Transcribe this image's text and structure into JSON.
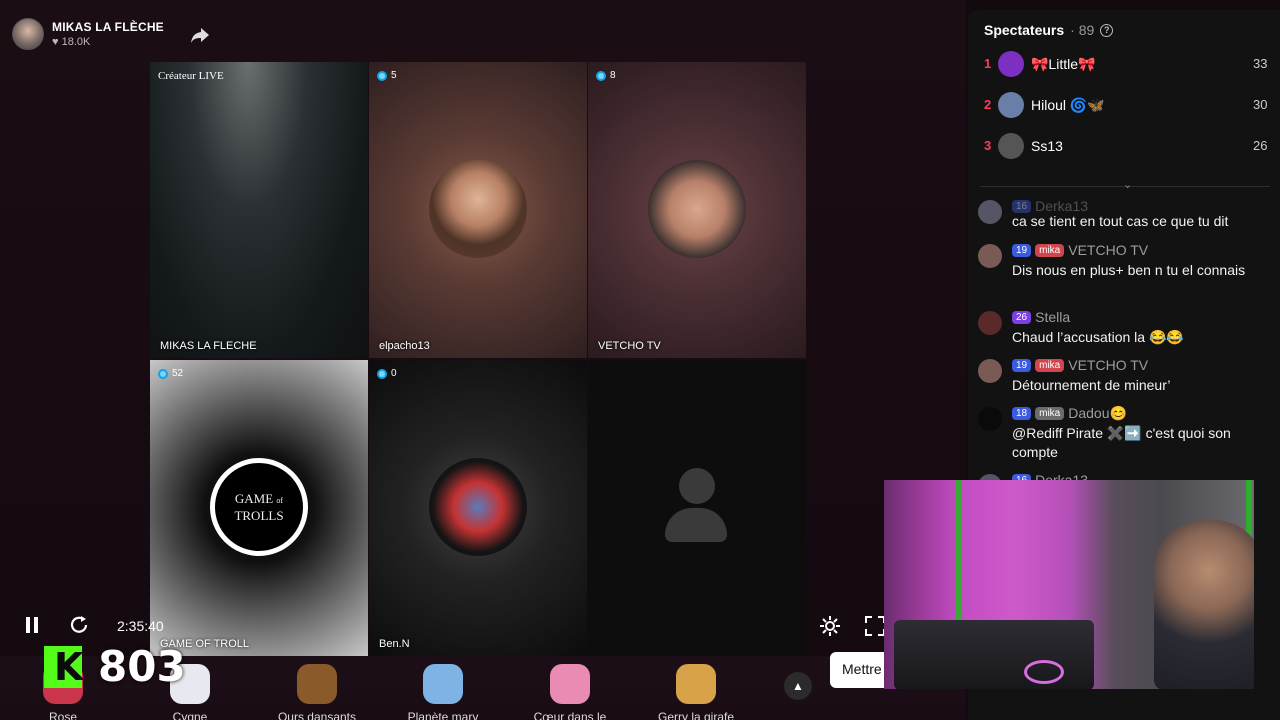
{
  "host": {
    "name": "MIKAS LA FLÈCHE",
    "likes": "18.0K"
  },
  "tiles": [
    {
      "name": "MIKAS LA FLECHE",
      "badge": "Créateur LIVE"
    },
    {
      "name": "elpacho13",
      "badge": "5"
    },
    {
      "name": "VETCHO TV",
      "badge": "8"
    },
    {
      "name": "GAME OF TROLL",
      "badge": "52",
      "logo_line1": "GAME",
      "logo_line2": "of",
      "logo_line3": "TROLLS"
    },
    {
      "name": "Ben.N",
      "badge": "0"
    },
    {
      "name": "",
      "badge": ""
    }
  ],
  "player": {
    "timer": "2:35:40"
  },
  "kick": {
    "count": "803"
  },
  "gifts": [
    {
      "label": "Rose",
      "color": "#c9354b"
    },
    {
      "label": "Cygne",
      "color": "#e8e8f0"
    },
    {
      "label": "Ours dansants",
      "color": "#8a5a2b"
    },
    {
      "label": "Planète mary",
      "color": "#7fb3e6"
    },
    {
      "label": "Cœur dans le",
      "color": "#e98bb3"
    },
    {
      "label": "Gerry la girafe",
      "color": "#d8a24a"
    }
  ],
  "mettre_label": "Mettre",
  "panel": {
    "title": "Spectateurs",
    "count": "· 89",
    "viewers": [
      {
        "rank": "1",
        "name": "🎀Little🎀",
        "score": "33",
        "color": "#7d2fc2"
      },
      {
        "rank": "2",
        "name": "Hiloul 🌀🦋",
        "score": "30",
        "color": "#6a7fa8"
      },
      {
        "rank": "3",
        "name": "Ss13",
        "score": "26",
        "color": "#555"
      }
    ],
    "messages": [
      {
        "level": "16",
        "fan": "",
        "name": "Derka13",
        "text": "ca se tient en tout cas ce que tu dit",
        "avatar": "#556"
      },
      {
        "level": "19",
        "fan": "mika",
        "name": "VETCHO TV",
        "text": "Dis nous en plus+ ben n tu el connais",
        "avatar": "#7a5a55"
      },
      {
        "level": "26",
        "fan": "",
        "name": "Stella",
        "text": "Chaud l’accusation la 😂😂",
        "avatar": "#5a2a2a"
      },
      {
        "level": "19",
        "fan": "mika",
        "name": "VETCHO TV",
        "text": "Détournement de mineur’",
        "avatar": "#7a5a55"
      },
      {
        "level": "18",
        "fan": "mika",
        "name": "Dadou😊",
        "text": "@Rediff Pirate ✖️➡️ c'est quoi son compte",
        "avatar": "#0a0a0a"
      },
      {
        "level": "16",
        "fan": "",
        "name": "Derka13",
        "text": "",
        "avatar": "#556"
      }
    ]
  }
}
